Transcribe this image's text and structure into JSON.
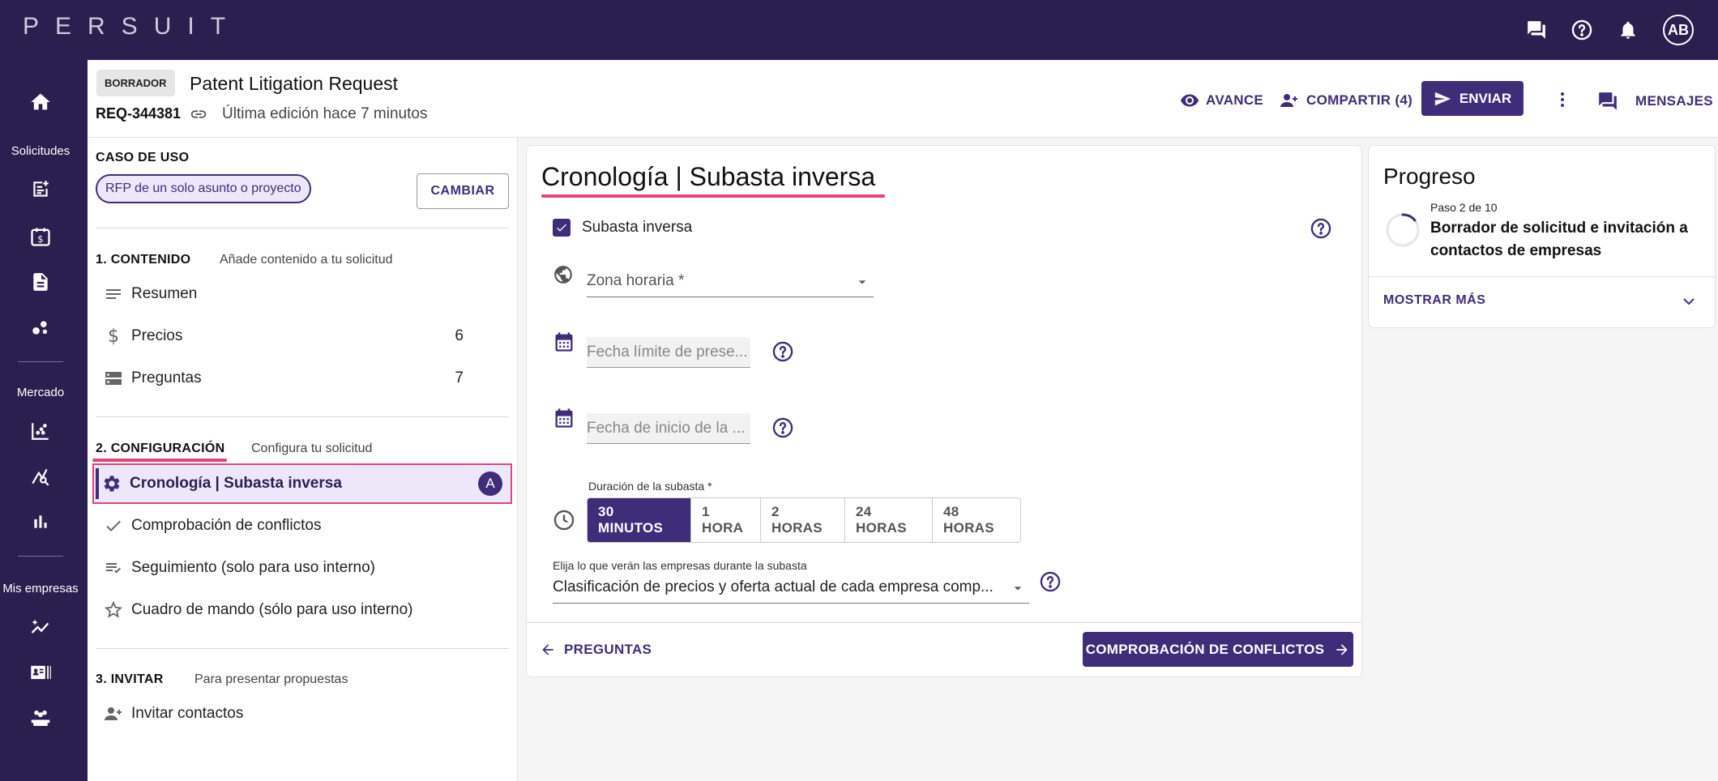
{
  "app": {
    "logo": "PERSUIT",
    "avatar": "AB"
  },
  "topbar": {
    "icons": [
      "chat-icon",
      "help-icon",
      "bell-icon"
    ]
  },
  "rail": {
    "sections": {
      "requests": "Solicitudes",
      "market": "Mercado",
      "companies": "Mis empresas"
    }
  },
  "header": {
    "status": "BORRADOR",
    "title": "Patent Litigation Request",
    "req_id": "REQ-344381",
    "last_edit": "Última edición hace 7 minutos",
    "preview": "AVANCE",
    "share": "COMPARTIR (4)",
    "send": "ENVIAR",
    "messages": "MENSAJES"
  },
  "sidebar": {
    "use_case_title": "CASO DE USO",
    "use_case_chip": "RFP de un solo asunto o proyecto",
    "change": "CAMBIAR",
    "content_title": "1. CONTENIDO",
    "content_sub": "Añade contenido a tu solicitud",
    "content_items": [
      {
        "label": "Resumen",
        "count": ""
      },
      {
        "label": "Precios",
        "count": "6"
      },
      {
        "label": "Preguntas",
        "count": "7"
      }
    ],
    "config_title": "2. CONFIGURACIÓN",
    "config_sub": "Configura tu solicitud",
    "config_items": [
      {
        "label": "Cronología | Subasta inversa",
        "badge": "A"
      },
      {
        "label": "Comprobación de conflictos"
      },
      {
        "label": "Seguimiento (solo para uso interno)"
      },
      {
        "label": "Cuadro de mando (sólo para uso interno)"
      }
    ],
    "invite_title": "3. INVITAR",
    "invite_sub": "Para presentar propuestas",
    "invite_items": [
      {
        "label": "Invitar contactos"
      }
    ]
  },
  "main": {
    "title": "Cronología | Subasta inversa",
    "reverse_auction_label": "Subasta inversa",
    "timezone_label": "Zona horaria  *",
    "deadline_placeholder": "Fecha límite de prese...",
    "start_placeholder": "Fecha de inicio de la ...",
    "duration_label": "Duración de la subasta *",
    "durations": [
      "30 MINUTOS",
      "1 HORA",
      "2 HORAS",
      "24 HORAS",
      "48 HORAS"
    ],
    "visibility_label": "Elija lo que verán las empresas durante la subasta",
    "visibility_value": "Clasificación de precios y oferta actual de cada empresa comp...",
    "back": "PREGUNTAS",
    "next": "COMPROBACIÓN DE CONFLICTOS"
  },
  "progress": {
    "title": "Progreso",
    "step": "Paso 2 de 10",
    "desc": "Borrador de solicitud e invitación a contactos de empresas",
    "more": "MOSTRAR MÁS"
  },
  "colors": {
    "brand": "#2b1f4f",
    "accent": "#3f2d7a",
    "highlight": "#e0457b"
  }
}
